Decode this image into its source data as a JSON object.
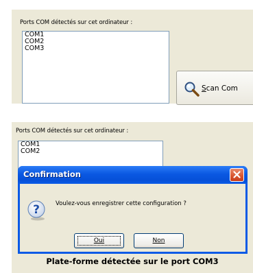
{
  "top_panel": {
    "ports_label": "Ports COM détectés sur cet ordinateur :",
    "ports": [
      "COM1",
      "COM2",
      "COM3"
    ],
    "scan_button": {
      "underline_char": "S",
      "rest_label": "can Com",
      "icon": "magnifier-icon"
    }
  },
  "bottom_panel": {
    "ports_label": "Ports COM détectés sur cet ordinateur :",
    "ports": [
      "COM1",
      "COM2"
    ],
    "status_text": "Plate-forme détectée sur le port COM3"
  },
  "dialog": {
    "title": "Confirmation",
    "message": "Voulez-vous enregistrer cette configuration ?",
    "icon": "question-icon",
    "yes_label": "Oui",
    "no_label": "Non",
    "close_icon": "close-icon"
  },
  "colors": {
    "panel_bg": "#ece9d8",
    "titlebar_blue": "#0a58e2",
    "close_red": "#d9552f",
    "listbox_border": "#7f9db9"
  }
}
